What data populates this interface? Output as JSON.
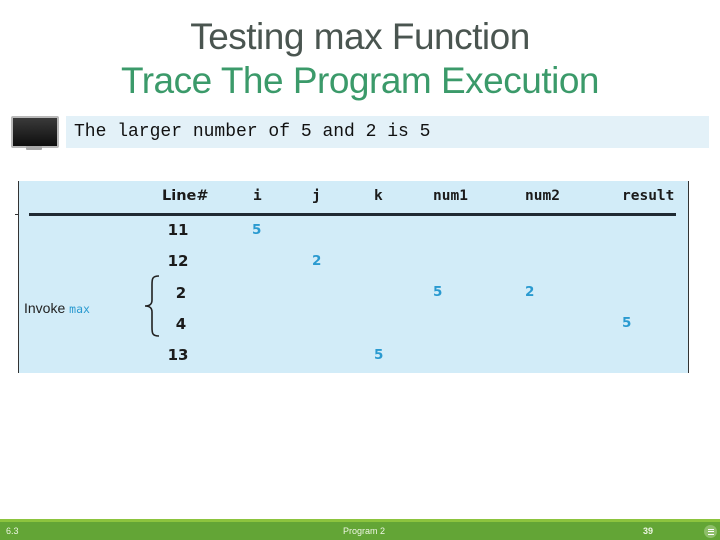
{
  "slide": {
    "title_line1": "Testing max Function",
    "title_line2": "Trace The Program Execution",
    "colors": {
      "title_primary": "#4a5550",
      "title_accent": "#3b9a6a",
      "value_blue": "#2a9ad0",
      "panel_bg": "#d2ecf8",
      "footer_green": "#63a536"
    }
  },
  "console": {
    "icon": "monitor-icon",
    "output": "The larger number of 5 and 2 is 5"
  },
  "trace_table": {
    "headers": {
      "line": "Line#",
      "i": "i",
      "j": "j",
      "k": "k",
      "num1": "num1",
      "num2": "num2",
      "result": "result"
    },
    "invoke_label": "Invoke",
    "invoke_method": "max",
    "rows": [
      {
        "line": "11",
        "i": "5",
        "j": "",
        "k": "",
        "num1": "",
        "num2": "",
        "result": ""
      },
      {
        "line": "12",
        "i": "",
        "j": "2",
        "k": "",
        "num1": "",
        "num2": "",
        "result": ""
      },
      {
        "line": "2",
        "i": "",
        "j": "",
        "k": "",
        "num1": "5",
        "num2": "2",
        "result": ""
      },
      {
        "line": "4",
        "i": "",
        "j": "",
        "k": "",
        "num1": "",
        "num2": "",
        "result": "5"
      },
      {
        "line": "13",
        "i": "",
        "j": "",
        "k": "5",
        "num1": "",
        "num2": "",
        "result": ""
      }
    ]
  },
  "footer": {
    "section": "6.3",
    "program": "Program 2",
    "page": "39",
    "menu_icon": "menu-icon"
  }
}
